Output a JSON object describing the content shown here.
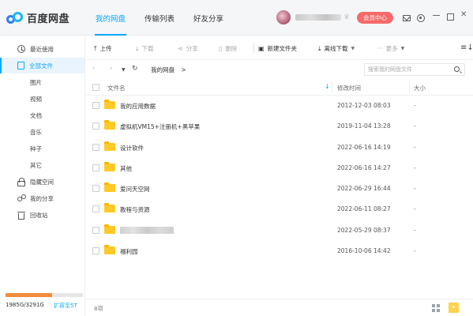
{
  "header": {
    "app_title": "百度网盘",
    "tabs": [
      {
        "label": "我的网盘",
        "active": true
      },
      {
        "label": "传输列表",
        "active": false
      },
      {
        "label": "好友分享",
        "active": false
      }
    ],
    "vip_label": "会员中心",
    "accent_color": "#06a7ff",
    "vip_color": "#f56a6a"
  },
  "sidebar": {
    "items": [
      {
        "label": "最近使用",
        "icon": "clock-icon",
        "active": false
      },
      {
        "label": "全部文件",
        "icon": "file-icon",
        "active": true
      },
      {
        "label": "图片",
        "sub": true
      },
      {
        "label": "视频",
        "sub": true
      },
      {
        "label": "文档",
        "sub": true
      },
      {
        "label": "音乐",
        "sub": true
      },
      {
        "label": "种子",
        "sub": true
      },
      {
        "label": "其它",
        "sub": true
      },
      {
        "label": "隐藏空间",
        "icon": "lock-icon"
      },
      {
        "label": "我的分享",
        "icon": "share-icon"
      },
      {
        "label": "回收站",
        "icon": "trash-icon"
      }
    ],
    "storage": {
      "used_text": "1985G/3291G",
      "upgrade_label": "扩容至5T",
      "used_fraction": 0.603
    }
  },
  "toolbar": {
    "upload": "上传",
    "download": "下载",
    "share": "分享",
    "delete": "删除",
    "new_folder": "新建文件夹",
    "offline_download": "离线下载",
    "more": "更多"
  },
  "path": {
    "current": "我的网盘",
    "separator": ">",
    "search_placeholder": "搜索我的网盘文件"
  },
  "table": {
    "headers": {
      "name": "文件名",
      "modified": "修改时间",
      "size": "大小"
    },
    "rows": [
      {
        "name": "我的应用数据",
        "modified": "2012-12-03 08:03",
        "size": "-"
      },
      {
        "name": "虚拟机VM15+注册机+黑苹果",
        "modified": "2019-11-04 13:28",
        "size": "-"
      },
      {
        "name": "设计软件",
        "modified": "2022-06-16 14:19",
        "size": "-"
      },
      {
        "name": "其他",
        "modified": "2022-06-16 14:27",
        "size": "-"
      },
      {
        "name": "爱问天空网",
        "modified": "2022-06-29 16:44",
        "size": "-"
      },
      {
        "name": "教程与资源",
        "modified": "2022-06-11 08:27",
        "size": "-"
      },
      {
        "name": "",
        "modified": "2022-05-29 08:37",
        "size": "-",
        "blurred": true
      },
      {
        "name": "福利园",
        "modified": "2016-10-06 14:42",
        "size": "-"
      }
    ]
  },
  "footer": {
    "item_count": "8项"
  }
}
